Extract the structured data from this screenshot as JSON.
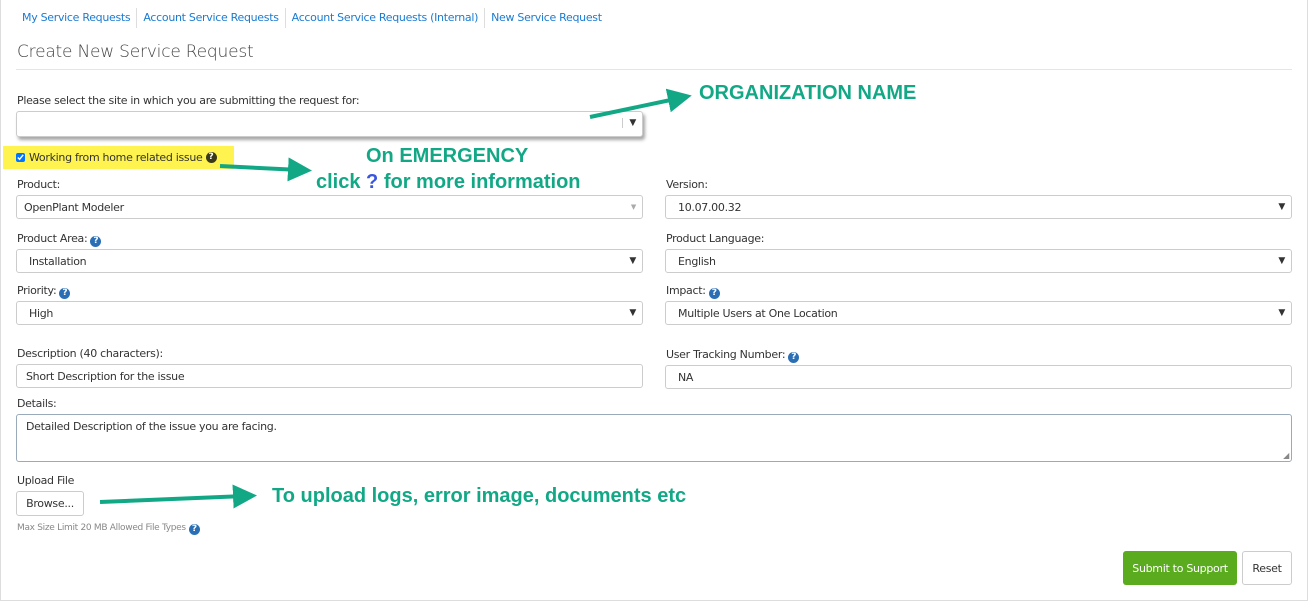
{
  "nav": [
    "My Service Requests",
    "Account Service Requests",
    "Account Service Requests (Internal)",
    "New Service Request"
  ],
  "title": "Create New Service Request",
  "site": {
    "label": "Please select the site in which you are submitting the request for:",
    "value": ""
  },
  "wfh": {
    "label": "Working from home related issue",
    "checked": true
  },
  "product": {
    "label": "Product:",
    "value": "OpenPlant Modeler"
  },
  "version": {
    "label": "Version:",
    "value": "10.07.00.32"
  },
  "product_area": {
    "label": "Product Area:",
    "value": "Installation"
  },
  "language": {
    "label": "Product Language:",
    "value": "English"
  },
  "priority": {
    "label": "Priority:",
    "value": "High"
  },
  "impact": {
    "label": "Impact:",
    "value": "Multiple Users at One Location"
  },
  "description": {
    "label": "Description (40 characters):",
    "value": "Short Description for the issue"
  },
  "tracking": {
    "label": "User Tracking Number:",
    "value": "NA"
  },
  "details": {
    "label": "Details:",
    "value": "Detailed Description of the issue you are facing."
  },
  "upload": {
    "label": "Upload File",
    "browse": "Browse...",
    "hint": "Max Size Limit 20 MB Allowed File Types"
  },
  "buttons": {
    "submit": "Submit to Support",
    "reset": "Reset"
  },
  "annotations": {
    "org": "ORGANIZATION NAME",
    "emergency1": "On EMERGENCY",
    "emergency2a": "click",
    "emergency2q": "?",
    "emergency2b": "for more information",
    "upload": "To upload logs, error image, documents etc"
  },
  "colors": {
    "annotation": "#12a886",
    "submit": "#5aab1e",
    "highlight": "#fff44f",
    "link": "#1a7bd1"
  }
}
